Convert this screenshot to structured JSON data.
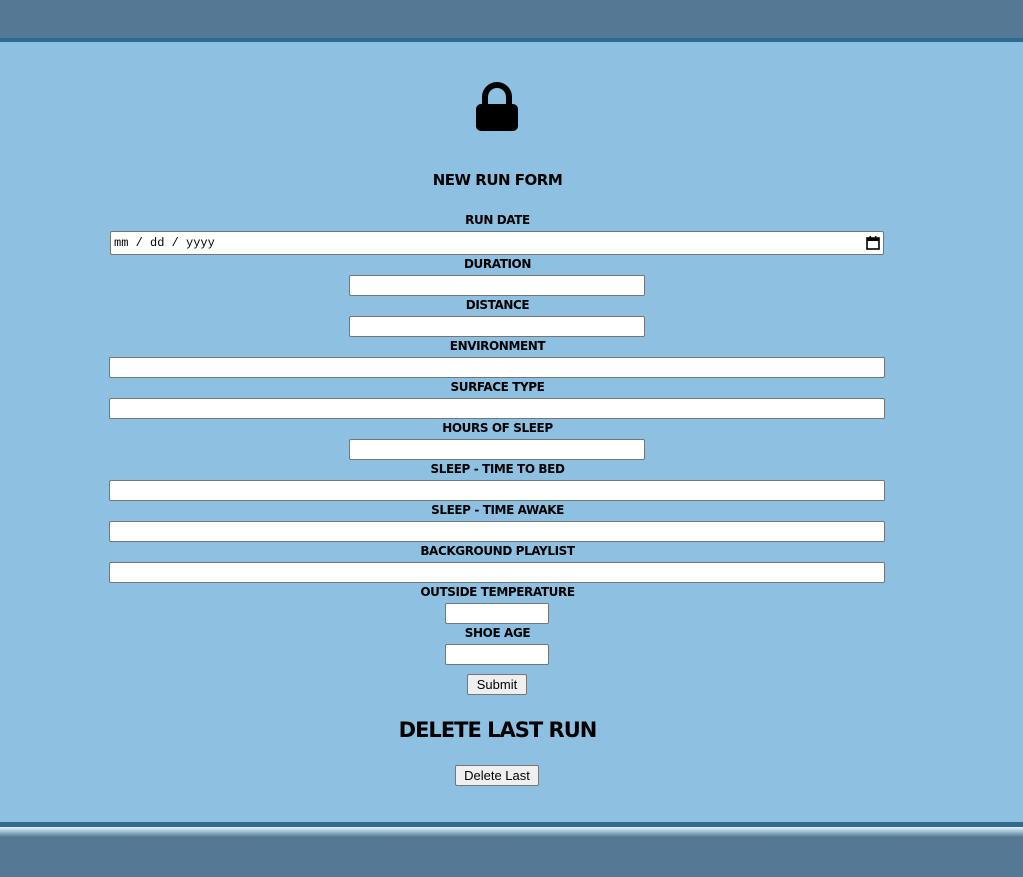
{
  "form": {
    "title": "New Run Form",
    "date_placeholder": "mm / dd / yyyy",
    "labels": {
      "run_date": "Run Date",
      "duration": "Duration",
      "distance": "Distance",
      "environment": "Environment",
      "surface_type": "Surface Type",
      "hours_of_sleep": "Hours of Sleep",
      "sleep_time_to_bed": "Sleep - Time to Bed",
      "sleep_time_awake": "Sleep - Time Awake",
      "background_playlist": "Background Playlist",
      "outside_temperature": "Outside Temperature",
      "shoe_age": "Shoe Age"
    },
    "values": {
      "duration": "",
      "distance": "",
      "environment": "",
      "surface_type": "",
      "hours_of_sleep": "",
      "sleep_time_to_bed": "",
      "sleep_time_awake": "",
      "background_playlist": "",
      "outside_temperature": "",
      "shoe_age": ""
    },
    "submit_label": "Submit"
  },
  "delete": {
    "title": "Delete Last Run",
    "button_label": "Delete Last"
  },
  "icons": {
    "lock": "lock-icon",
    "calendar": "calendar-icon"
  },
  "colors": {
    "background": "#8ec0e2",
    "bar": "#557995",
    "bar_edge": "#2f6a93"
  }
}
